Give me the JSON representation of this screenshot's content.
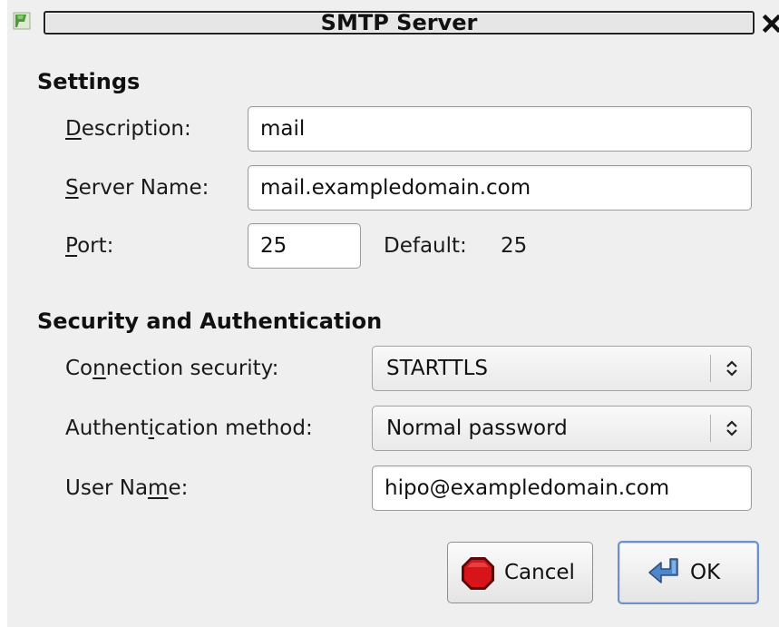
{
  "window": {
    "title": "SMTP Server"
  },
  "settings": {
    "heading": "Settings",
    "description": {
      "label_mnemonic": "D",
      "label_rest": "escription:",
      "value": "mail"
    },
    "server_name": {
      "label_mnemonic": "S",
      "label_rest": "erver Name:",
      "value": "mail.exampledomain.com"
    },
    "port": {
      "label_mnemonic": "P",
      "label_rest": "ort:",
      "value": "25",
      "default_label": "Default:",
      "default_value": "25"
    }
  },
  "security": {
    "heading": "Security and Authentication",
    "connection": {
      "label_pre": "Co",
      "label_mnemonic": "n",
      "label_post": "nection security:",
      "value": "STARTTLS"
    },
    "auth_method": {
      "label_pre": "Authent",
      "label_mnemonic": "i",
      "label_post": "cation method:",
      "value": "Normal password"
    },
    "user_name": {
      "label_pre": "User Na",
      "label_mnemonic": "m",
      "label_post": "e:",
      "value": "hipo@exampledomain.com"
    }
  },
  "buttons": {
    "cancel": "Cancel",
    "ok": "OK"
  },
  "icons": {
    "app": "app-icon",
    "close": "close-icon",
    "cancel": "stop-icon",
    "ok": "enter-arrow-icon",
    "combo": "updown-arrows-icon"
  },
  "colors": {
    "cancel_icon": "#d8141b",
    "ok_icon": "#4f86c9",
    "default_button_border": "#6f8fc9"
  }
}
